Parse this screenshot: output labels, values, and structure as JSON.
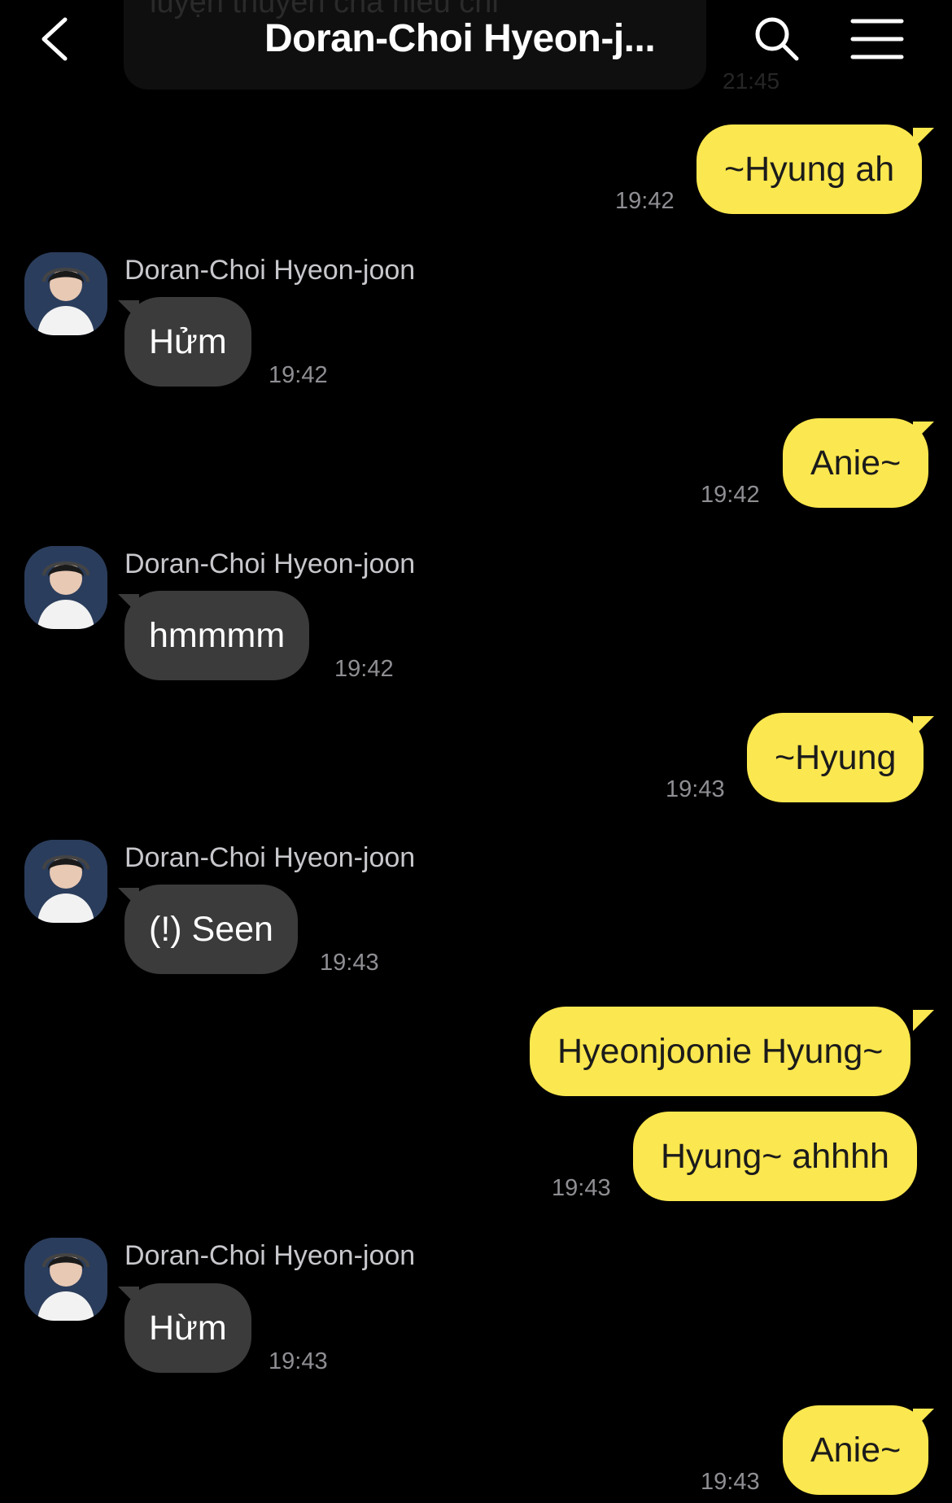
{
  "header": {
    "title": "Doran-Choi Hyeon-j...",
    "back_icon": "chevron-left-icon",
    "search_icon": "search-icon",
    "menu_icon": "menu-icon"
  },
  "previous_message": {
    "text": "luyện thuyền cha nieu chi",
    "time": "21:45"
  },
  "contact": {
    "name": "Doran-Choi Hyeon-joon"
  },
  "messages": [
    {
      "side": "out",
      "text": "~Hyung ah",
      "time": "19:42"
    },
    {
      "side": "in",
      "sender": "Doran-Choi Hyeon-joon",
      "text": "Hửm",
      "time": "19:42"
    },
    {
      "side": "out",
      "text": "Anie~",
      "time": "19:42"
    },
    {
      "side": "in",
      "sender": "Doran-Choi Hyeon-joon",
      "text": "hmmmm",
      "time": "19:42"
    },
    {
      "side": "out",
      "text": "~Hyung",
      "time": "19:43"
    },
    {
      "side": "in",
      "sender": "Doran-Choi Hyeon-joon",
      "text": "(!) Seen",
      "time": "19:43"
    },
    {
      "side": "out",
      "text": "Hyeonjoonie Hyung~"
    },
    {
      "side": "out",
      "text": "Hyung~ ahhhh",
      "time": "19:43"
    },
    {
      "side": "in",
      "sender": "Doran-Choi Hyeon-joon",
      "text": "Hừm",
      "time": "19:43"
    },
    {
      "side": "out",
      "text": "Anie~",
      "time": "19:43"
    }
  ],
  "colors": {
    "background": "#000000",
    "outgoing_bubble": "#fbe74f",
    "incoming_bubble": "#3b3b3c",
    "timestamp": "#8e8e93"
  }
}
